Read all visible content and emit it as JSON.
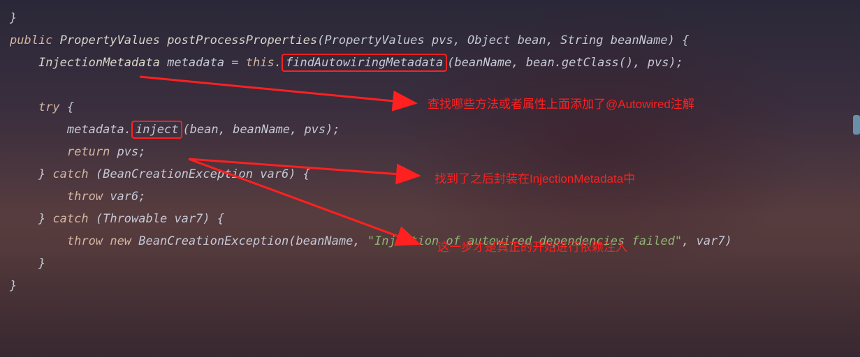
{
  "code": {
    "line0": "}",
    "line1_kw": "public",
    "line1_type1": " PropertyValues ",
    "line1_method": "postProcessProperties",
    "line1_params": "(PropertyValues pvs, Object bean, String beanName) {",
    "line2_indent": "    ",
    "line2_type": "InjectionMetadata ",
    "line2_var": "metadata = ",
    "line2_this": "this",
    "line2_dot": ".",
    "line2_hl": "findAutowiringMetadata",
    "line2_rest": "(beanName, bean.getClass(), pvs);",
    "line3": "",
    "line4_indent": "    ",
    "line4_kw": "try",
    "line4_rest": " {",
    "line5_indent": "        ",
    "line5_a": "metadata.",
    "line5_hl": "inject",
    "line5_b": "(bean, beanName, ",
    "line5_c": "pvs);",
    "line6_indent": "        ",
    "line6_kw": "return",
    "line6_rest": " pvs;",
    "line7_indent": "    ",
    "line7_a": "} ",
    "line7_kw": "catch",
    "line7_b": " (BeanCreationException var6) {",
    "line8_indent": "        ",
    "line8_kw": "throw",
    "line8_rest": " var6;",
    "line9_indent": "    ",
    "line9_a": "} ",
    "line9_kw": "catch",
    "line9_b": " (Throwable var7) {",
    "line10_indent": "        ",
    "line10_kw1": "throw",
    "line10_sp": " ",
    "line10_kw2": "new",
    "line10_a": " BeanCreationException(beanName, ",
    "line10_str": "\"Injection of autowired dependencies failed\"",
    "line10_b": ", var7)",
    "line11_indent": "    ",
    "line11": "}",
    "line12": "}"
  },
  "annotations": {
    "a1": "查找哪些方法或者属性上面添加了@Autowired注解",
    "a2": "找到了之后封装在InjectionMetadata中",
    "a3": "这一步才是真正的开始进行依赖注入"
  }
}
